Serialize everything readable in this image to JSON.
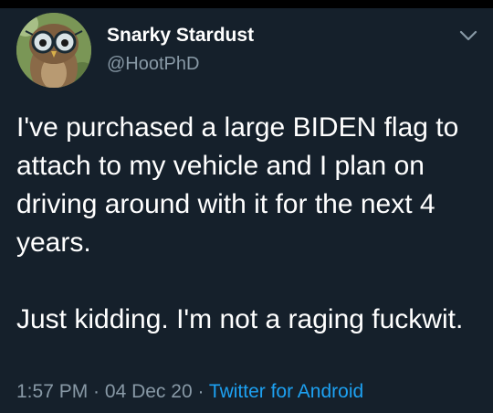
{
  "user": {
    "display_name": "Snarky Stardust",
    "handle": "@HootPhD"
  },
  "tweet": {
    "paragraph_1": "I've purchased a large BIDEN flag to attach to my vehicle and I plan on driving around with it for the next 4 years.",
    "paragraph_2": "Just kidding. I'm not a raging fuckwit."
  },
  "meta": {
    "time": "1:57 PM",
    "separator": " · ",
    "date": "04 Dec 20",
    "source": "Twitter for Android"
  },
  "icons": {
    "menu": "chevron-down-icon",
    "avatar": "owl-with-glasses"
  },
  "colors": {
    "background": "#15202b",
    "secondary_text": "#8899a6",
    "link": "#1da1f2"
  }
}
